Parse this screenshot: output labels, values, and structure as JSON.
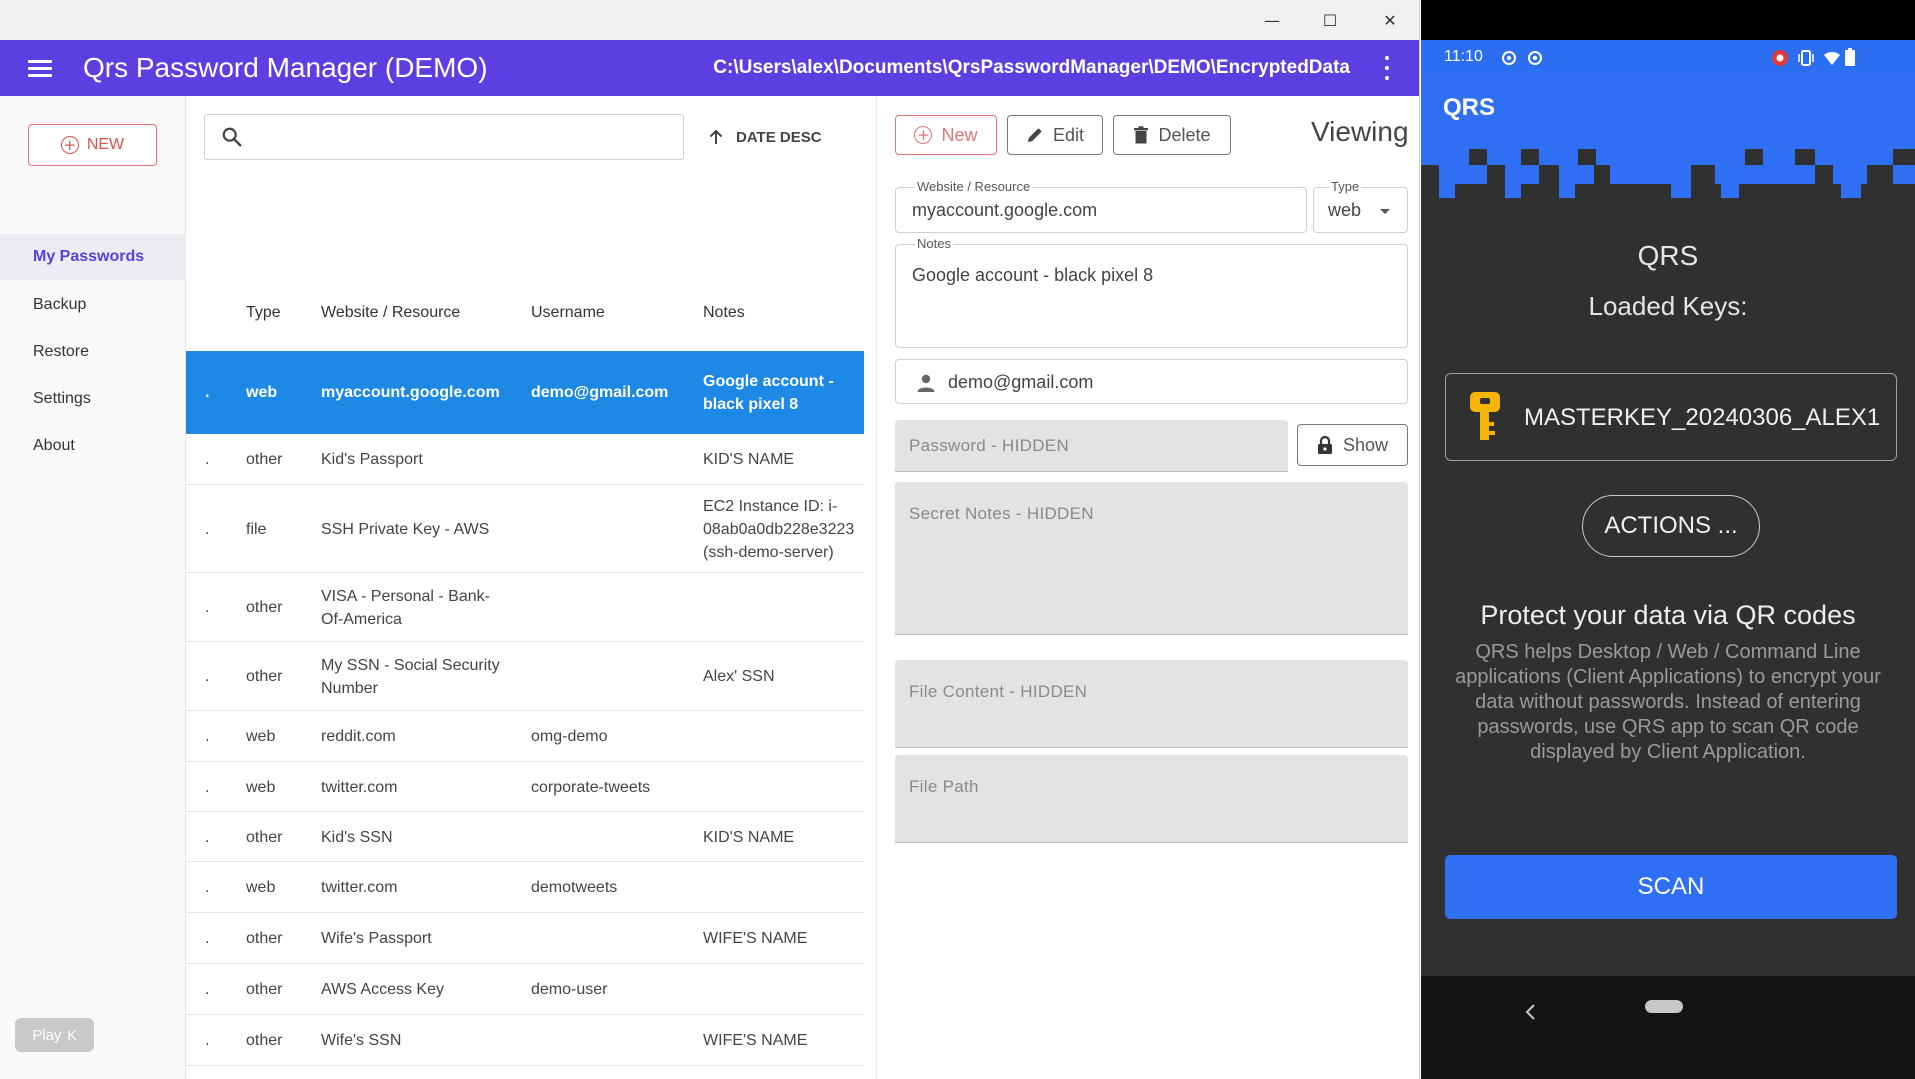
{
  "window": {
    "app_title": "Qrs Password Manager (DEMO)",
    "file_path": "C:\\Users\\alex\\Documents\\QrsPasswordManager\\DEMO\\EncryptedData",
    "controls": {
      "minimize": "—",
      "maximize": "☐",
      "close": "✕"
    }
  },
  "sidebar": {
    "new_label": "NEW",
    "items": [
      {
        "label": "My Passwords",
        "active": true
      },
      {
        "label": "Backup"
      },
      {
        "label": "Restore"
      },
      {
        "label": "Settings"
      },
      {
        "label": "About"
      }
    ]
  },
  "list": {
    "search_placeholder": "",
    "sort_label": "DATE DESC",
    "columns": {
      "type": "Type",
      "site": "Website / Resource",
      "user": "Username",
      "notes": "Notes"
    },
    "rows": [
      {
        "dot": ".",
        "type": "web",
        "site": "myaccount.google.com",
        "user": "demo@gmail.com",
        "notes": "Google account - black pixel 8",
        "selected": true
      },
      {
        "dot": ".",
        "type": "other",
        "site": "Kid's Passport",
        "user": "",
        "notes": "KID'S NAME"
      },
      {
        "dot": ".",
        "type": "file",
        "site": "SSH Private Key - AWS",
        "user": "",
        "notes": "EC2 Instance ID: i-08ab0a0db228e3223 (ssh-demo-server)"
      },
      {
        "dot": ".",
        "type": "other",
        "site": "VISA - Personal - Bank-Of-America",
        "user": "",
        "notes": ""
      },
      {
        "dot": ".",
        "type": "other",
        "site": "My SSN - Social Security Number",
        "user": "",
        "notes": "Alex' SSN"
      },
      {
        "dot": ".",
        "type": "web",
        "site": "reddit.com",
        "user": "omg-demo",
        "notes": ""
      },
      {
        "dot": ".",
        "type": "web",
        "site": "twitter.com",
        "user": "corporate-tweets",
        "notes": ""
      },
      {
        "dot": ".",
        "type": "other",
        "site": "Kid's SSN",
        "user": "",
        "notes": "KID'S NAME"
      },
      {
        "dot": ".",
        "type": "web",
        "site": "twitter.com",
        "user": "demotweets",
        "notes": ""
      },
      {
        "dot": ".",
        "type": "other",
        "site": "Wife's Passport",
        "user": "",
        "notes": "WIFE'S NAME"
      },
      {
        "dot": ".",
        "type": "other",
        "site": "AWS Access Key",
        "user": "demo-user",
        "notes": ""
      },
      {
        "dot": ".",
        "type": "other",
        "site": "Wife's SSN",
        "user": "",
        "notes": "WIFE'S NAME"
      }
    ]
  },
  "detail": {
    "buttons": {
      "new": "New",
      "edit": "Edit",
      "delete": "Delete"
    },
    "mode": "Viewing",
    "website_label": "Website / Resource",
    "website_value": "myaccount.google.com",
    "type_label": "Type",
    "type_value": "web",
    "notes_label": "Notes",
    "notes_value": "Google account - black pixel 8",
    "username_value": "demo@gmail.com",
    "password_placeholder": "Password - HIDDEN",
    "show_label": "Show",
    "secret_notes_placeholder": "Secret Notes - HIDDEN",
    "file_content_placeholder": "File Content - HIDDEN",
    "file_path_placeholder": "File Path"
  },
  "badge": {
    "play": "Play",
    "key": "K"
  },
  "phone": {
    "time": "11:10",
    "app_title": "QRS",
    "heading": "QRS",
    "loaded_keys": "Loaded Keys:",
    "key_name": "MASTERKEY_20240306_ALEX1",
    "actions": "ACTIONS ...",
    "protect_heading": "Protect your data via QR codes",
    "protect_desc": "QRS helps Desktop / Web / Command Line applications (Client Applications) to encrypt your data without passwords. Instead of entering passwords, use QRS app to scan QR code displayed by Client Application.",
    "scan": "SCAN"
  },
  "colors": {
    "accent": "#5b3fe0",
    "selected_row": "#1e88e5",
    "phone_blue": "#2f6ff3",
    "danger": "#e57373"
  }
}
